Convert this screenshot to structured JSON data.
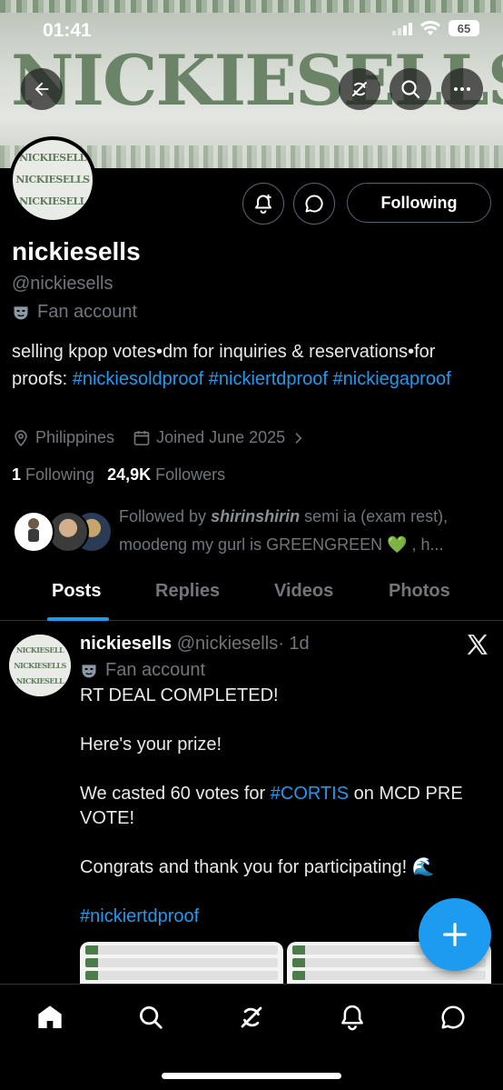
{
  "status_bar": {
    "time": "01:41",
    "battery": "65"
  },
  "banner": {
    "text": "NICKIESELLS"
  },
  "avatar": {
    "lines": [
      "NICKIESELL",
      "NICKIESELLS",
      "NICKIESELL"
    ]
  },
  "profile": {
    "following_button": "Following",
    "name": "nickiesells",
    "handle": "@nickiesells",
    "label": "Fan account",
    "bio_text": "selling kpop votes•dm for inquiries & reservations•for proofs: ",
    "bio_tags": [
      "#nickiesoldproof",
      "#nickiertdproof",
      "#nickiegaproof"
    ],
    "location": "Philippines",
    "joined": "Joined June 2025",
    "following_count": "1",
    "following_label": "Following",
    "followers_count": "24,9K",
    "followers_label": "Followers",
    "followed_by_prefix": "Followed by ",
    "followed_by_name": "shirinshirin",
    "followed_by_rest": " semi ia (exam rest), moodeng my gurl is GREENGREEN 💚 , h..."
  },
  "tabs": [
    "Posts",
    "Replies",
    "Videos",
    "Photos"
  ],
  "post": {
    "author_name": "nickiesells",
    "author_handle": "@nickiesells",
    "time": "· 1d",
    "label": "Fan account",
    "line1": "RT DEAL COMPLETED!",
    "line2": "Here's your prize!",
    "line3_pre": "We casted 60 votes for ",
    "line3_tag": "#CORTIS",
    "line3_post": " on MCD PRE VOTE!",
    "line4": "Congrats and thank you for participating! 🌊",
    "tag": "#nickiertdproof"
  },
  "colors": {
    "accent": "#1d9bf0",
    "muted": "#71767b",
    "background": "#000000"
  }
}
